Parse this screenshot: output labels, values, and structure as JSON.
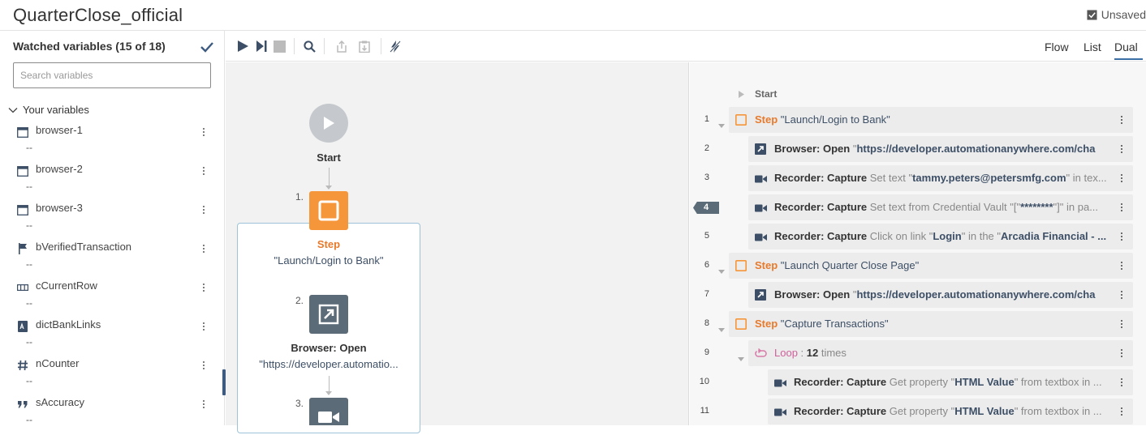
{
  "title": "QuarterClose_official",
  "status": "Unsaved",
  "sidebar": {
    "header": "Watched variables (15 of 18)",
    "search_placeholder": "Search variables",
    "section": "Your variables",
    "variables": [
      {
        "name": "browser-1",
        "value": "--",
        "icon": "window-icon"
      },
      {
        "name": "browser-2",
        "value": "--",
        "icon": "window-icon"
      },
      {
        "name": "browser-3",
        "value": "--",
        "icon": "window-icon"
      },
      {
        "name": "bVerifiedTransaction",
        "value": "--",
        "icon": "flag-icon"
      },
      {
        "name": "cCurrentRow",
        "value": "--",
        "icon": "row-icon"
      },
      {
        "name": "dictBankLinks",
        "value": "--",
        "icon": "dictionary-icon"
      },
      {
        "name": "nCounter",
        "value": "--",
        "icon": "hash-icon"
      },
      {
        "name": "sAccuracy",
        "value": "--",
        "icon": "quote-icon"
      }
    ]
  },
  "view_tabs": [
    "Flow",
    "List",
    "Dual"
  ],
  "active_tab": "Dual",
  "flow": {
    "start_label": "Start",
    "step1_num": "1.",
    "step1_type": "Step",
    "step1_name": "\"Launch/Login to Bank\"",
    "step2_num": "2.",
    "step2_type": "Browser: Open",
    "step2_detail": "\"https://developer.automatio...",
    "step3_num": "3."
  },
  "list": {
    "start_label": "Start",
    "rows": [
      {
        "num": "1",
        "kind": "step",
        "label": "Step",
        "text": "\"Launch/Login to Bank\""
      },
      {
        "num": "2",
        "kind": "browser",
        "label": "Browser: Open",
        "pre": "\"",
        "hl": "https://developer.automationanywhere.com/cha",
        "post": ""
      },
      {
        "num": "3",
        "kind": "recorder",
        "label": "Recorder: Capture",
        "pre": "Set text \"",
        "hl": "tammy.peters@petersmfg.com",
        "post": "\" in tex..."
      },
      {
        "num": "4",
        "kind": "recorder",
        "label": "Recorder: Capture",
        "pre": "Set text from Credential Vault \"[\"",
        "hl": "********",
        "post": "\"]\" in pa..."
      },
      {
        "num": "5",
        "kind": "recorder",
        "label": "Recorder: Capture",
        "pre": "Click on link \"",
        "hl": "Login",
        "post": "\" in the \"",
        "hl2": "Arcadia Financial - ..."
      },
      {
        "num": "6",
        "kind": "step",
        "label": "Step",
        "text": "\"Launch Quarter Close Page\""
      },
      {
        "num": "7",
        "kind": "browser",
        "label": "Browser: Open",
        "pre": "\"",
        "hl": "https://developer.automationanywhere.com/cha",
        "post": ""
      },
      {
        "num": "8",
        "kind": "step",
        "label": "Step",
        "text": "\"Capture Transactions\""
      },
      {
        "num": "9",
        "kind": "loop",
        "label": "Loop",
        "pre": " : ",
        "hl": "12",
        "post": " times"
      },
      {
        "num": "10",
        "kind": "recorder",
        "label": "Recorder: Capture",
        "pre": "Get property \"",
        "hl": "HTML Value",
        "post": "\" from textbox in ..."
      },
      {
        "num": "11",
        "kind": "recorder",
        "label": "Recorder: Capture",
        "pre": "Get property \"",
        "hl": "HTML Value",
        "post": "\" from textbox in ..."
      }
    ]
  },
  "colors": {
    "step_orange": "#f5963a",
    "browser_gray": "#5c6b78",
    "accent_blue": "#3a6ea5"
  }
}
